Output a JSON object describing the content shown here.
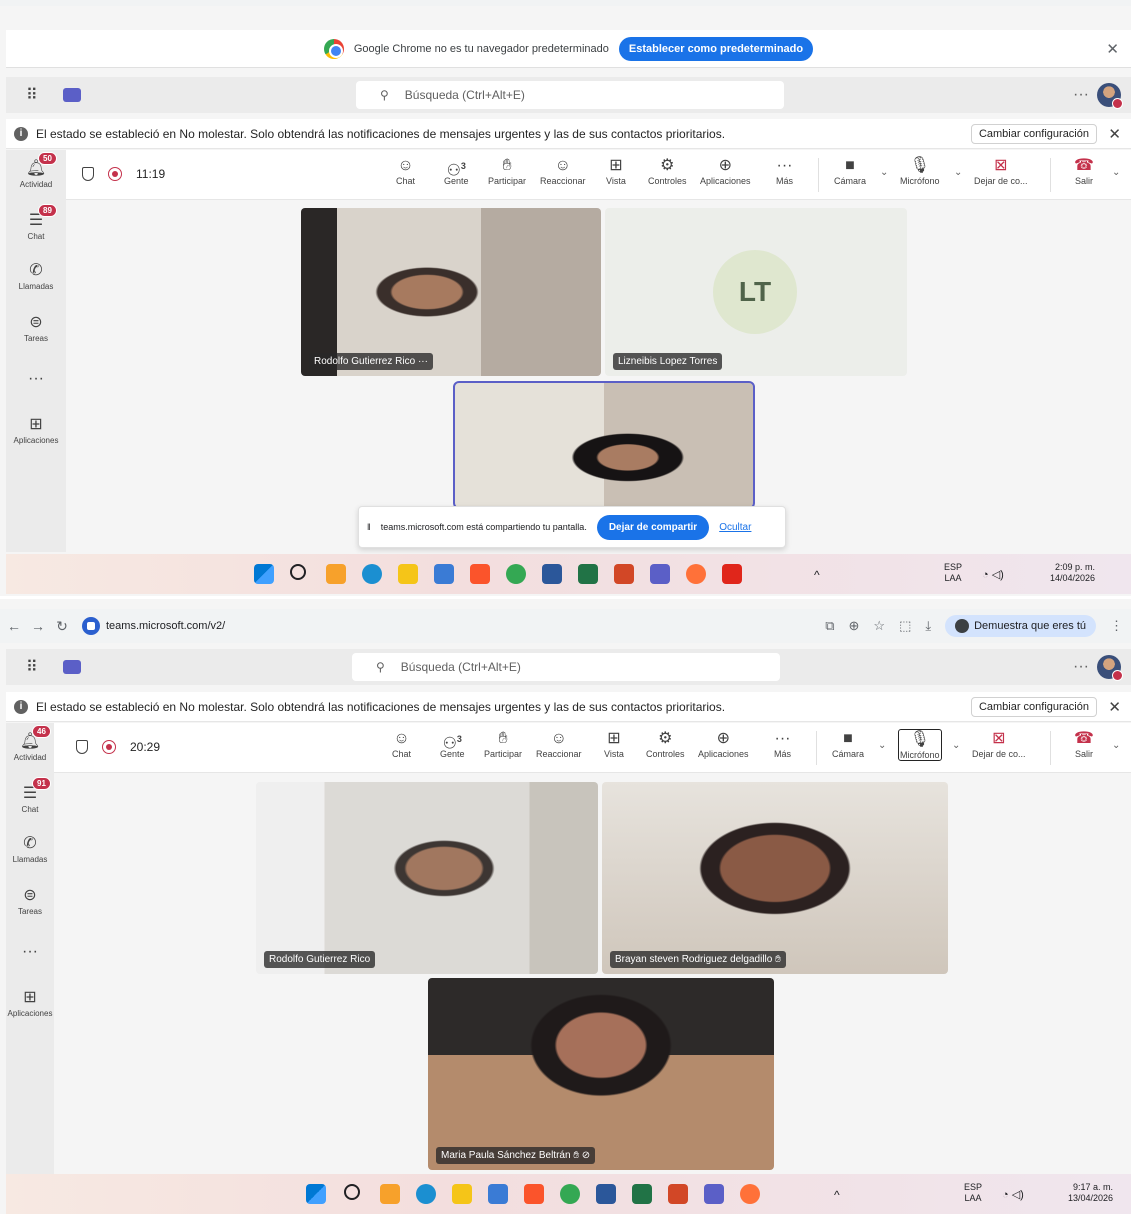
{
  "screenshots": [
    {
      "browser": {
        "url": "teams.microsoft.com/v2/",
        "profile_label": "Demuestra que eres tú"
      },
      "chrome_notice": {
        "text": "Google Chrome no es tu navegador predeterminado",
        "button": "Establecer como predeterminado"
      },
      "search_placeholder": "Búsqueda (Ctrl+Alt+E)",
      "status_message": "El estado se estableció en No molestar. Solo obtendrá las notificaciones de mensajes urgentes y las de sus contactos prioritarios.",
      "change_settings": "Cambiar configuración",
      "rail": [
        {
          "label": "Actividad",
          "badge": "50"
        },
        {
          "label": "Chat",
          "badge": "89"
        },
        {
          "label": "Llamadas"
        },
        {
          "label": "Tareas"
        },
        {
          "label": "Aplicaciones"
        }
      ],
      "meeting_time": "11:19",
      "people_count": "3",
      "participants": [
        {
          "name": "Rodolfo Gutierrez Rico",
          "more": "···"
        },
        {
          "name": "Lizneibis Lopez Torres",
          "initials": "LT"
        },
        {
          "name": ""
        }
      ],
      "share_banner": {
        "text": "teams.microsoft.com está compartiendo tu pantalla.",
        "stop": "Dejar de compartir",
        "hide": "Ocultar"
      },
      "taskbar": {
        "lang": "ESP",
        "layout": "LAA",
        "time": "2:09 p. m.",
        "date": "14/04/2026"
      }
    },
    {
      "browser": {
        "url": "teams.microsoft.com/v2/",
        "profile_label": "Demuestra que eres tú"
      },
      "search_placeholder": "Búsqueda (Ctrl+Alt+E)",
      "status_message": "El estado se estableció en No molestar. Solo obtendrá las notificaciones de mensajes urgentes y las de sus contactos prioritarios.",
      "change_settings": "Cambiar configuración",
      "rail": [
        {
          "label": "Actividad",
          "badge": "46"
        },
        {
          "label": "Chat",
          "badge": "91"
        },
        {
          "label": "Llamadas"
        },
        {
          "label": "Tareas"
        },
        {
          "label": "Aplicaciones"
        }
      ],
      "meeting_time": "20:29",
      "people_count": "3",
      "participants": [
        {
          "name": "Rodolfo Gutierrez Rico"
        },
        {
          "name": "Brayan steven Rodriguez delgadillo"
        },
        {
          "name": "Maria Paula Sánchez Beltrán"
        }
      ],
      "taskbar": {
        "lang": "ESP",
        "layout": "LAA",
        "time": "9:17 a. m.",
        "date": "13/04/2026"
      }
    }
  ],
  "toolbar": {
    "chat": "Chat",
    "people": "Gente",
    "raise": "Participar",
    "react": "Reaccionar",
    "view": "Vista",
    "controls": "Controles",
    "apps": "Aplicaciones",
    "more": "Más",
    "camera": "Cámara",
    "mic": "Micrófono",
    "stop_present": "Dejar de co...",
    "leave": "Salir",
    "more_dots": "···"
  },
  "colors": {
    "accent": "#5b5fc7",
    "leave": "#c4314b",
    "chrome_blue": "#1a73e8",
    "badge": "#c4314b"
  },
  "icons": [
    "apps-grid-icon",
    "teams-logo-icon",
    "search-icon",
    "info-icon",
    "shield-icon",
    "record-icon",
    "chat-icon",
    "people-icon",
    "hand-icon",
    "emoji-icon",
    "grid-view-icon",
    "controls-icon",
    "add-app-icon",
    "camera-icon",
    "mic-icon",
    "share-stop-icon",
    "hang-up-icon",
    "chevron-down-icon",
    "close-icon"
  ]
}
